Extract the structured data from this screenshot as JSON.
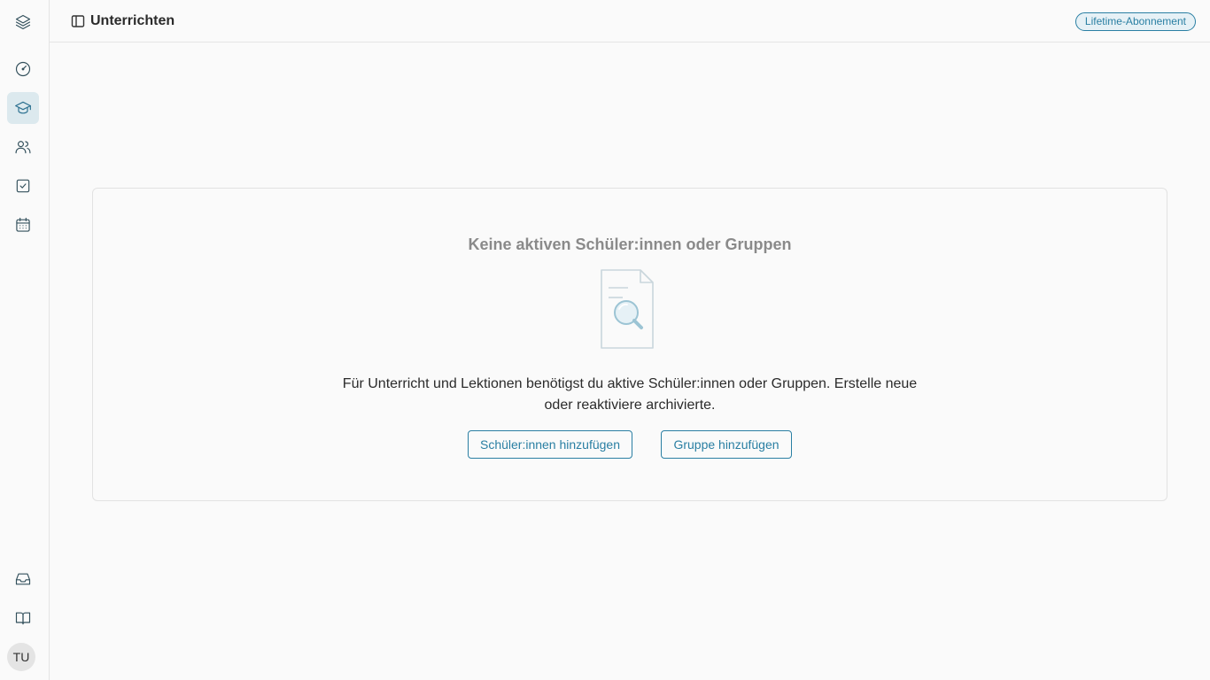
{
  "sidebar": {
    "items": [
      {
        "icon": "layers-icon"
      },
      {
        "icon": "dashboard-gauge-icon"
      },
      {
        "icon": "graduation-cap-icon",
        "active": true
      },
      {
        "icon": "users-icon"
      },
      {
        "icon": "checkbox-icon"
      },
      {
        "icon": "calendar-icon"
      }
    ],
    "bottom_items": [
      {
        "icon": "inbox-icon"
      },
      {
        "icon": "book-open-icon"
      }
    ],
    "avatar_initials": "TU"
  },
  "header": {
    "toggle_icon": "sidebar-panel-icon",
    "title": "Unterrichten",
    "badge": "Lifetime-Abonnement"
  },
  "empty_state": {
    "title": "Keine aktiven Schüler:innen oder Gruppen",
    "illustration": "document-search-icon",
    "text": "Für Unterricht und Lektionen benötigst du aktive Schüler:innen oder Gruppen. Erstelle neue oder reaktiviere archivierte.",
    "add_student_label": "Schüler:innen hinzufügen",
    "add_group_label": "Gruppe hinzufügen"
  },
  "colors": {
    "accent": "#2a7fa3",
    "active_nav_bg": "#dce9ee",
    "background": "#fafafa",
    "border": "#e4e4e4"
  }
}
